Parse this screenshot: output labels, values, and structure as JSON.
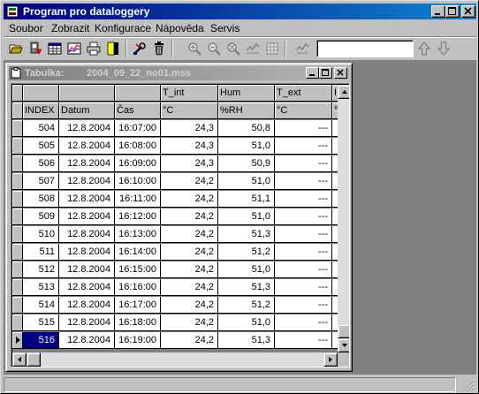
{
  "window": {
    "title": "Program pro dataloggery"
  },
  "menu": [
    {
      "label": "Soubor"
    },
    {
      "label": "Zobrazit"
    },
    {
      "label": "Konfigurace"
    },
    {
      "label": "Nápověda"
    },
    {
      "label": "Servis"
    }
  ],
  "toolbar": {
    "icons": [
      "open-folder-icon",
      "download-icon",
      "table-icon",
      "graph-icon",
      "print-icon",
      "export-icon",
      "wrench-icon",
      "trash-icon",
      "zoom-in-icon",
      "zoom-out-icon",
      "zoom-reset-icon",
      "mark-icon",
      "grid-icon",
      "find-icon",
      "arrow-up-icon",
      "arrow-down-icon"
    ],
    "search_value": ""
  },
  "table_window": {
    "label": "Tabulka:",
    "file": "2004_09_22_no01.mss"
  },
  "table": {
    "header_top": [
      "",
      "",
      "",
      "T_int",
      "Hum",
      "T_ext",
      "I"
    ],
    "header_bottom": [
      "INDEX",
      "Datum",
      "Čas",
      "°C",
      "%RH",
      "°C",
      "°"
    ],
    "rows": [
      [
        "504",
        "12.8.2004",
        "16:07:00",
        "24,3",
        "50,8",
        "---"
      ],
      [
        "505",
        "12.8.2004",
        "16:08:00",
        "24,3",
        "51,0",
        "---"
      ],
      [
        "506",
        "12.8.2004",
        "16:09:00",
        "24,3",
        "50,9",
        "---"
      ],
      [
        "507",
        "12.8.2004",
        "16:10:00",
        "24,2",
        "51,0",
        "---"
      ],
      [
        "508",
        "12.8.2004",
        "16:11:00",
        "24,2",
        "51,1",
        "---"
      ],
      [
        "509",
        "12.8.2004",
        "16:12:00",
        "24,2",
        "51,0",
        "---"
      ],
      [
        "510",
        "12.8.2004",
        "16:13:00",
        "24,2",
        "51,3",
        "---"
      ],
      [
        "511",
        "12.8.2004",
        "16:14:00",
        "24,2",
        "51,2",
        "---"
      ],
      [
        "512",
        "12.8.2004",
        "16:15:00",
        "24,2",
        "51,0",
        "---"
      ],
      [
        "513",
        "12.8.2004",
        "16:16:00",
        "24,2",
        "51,3",
        "---"
      ],
      [
        "514",
        "12.8.2004",
        "16:17:00",
        "24,2",
        "51,2",
        "---"
      ],
      [
        "515",
        "12.8.2004",
        "16:18:00",
        "24,2",
        "51,0",
        "---"
      ],
      [
        "516",
        "12.8.2004",
        "16:19:00",
        "24,2",
        "51,3",
        "---"
      ]
    ],
    "selected_row": 12
  },
  "colors": {
    "titlebar": "#000080",
    "selection": "#000080",
    "face": "#c0c0c0"
  }
}
